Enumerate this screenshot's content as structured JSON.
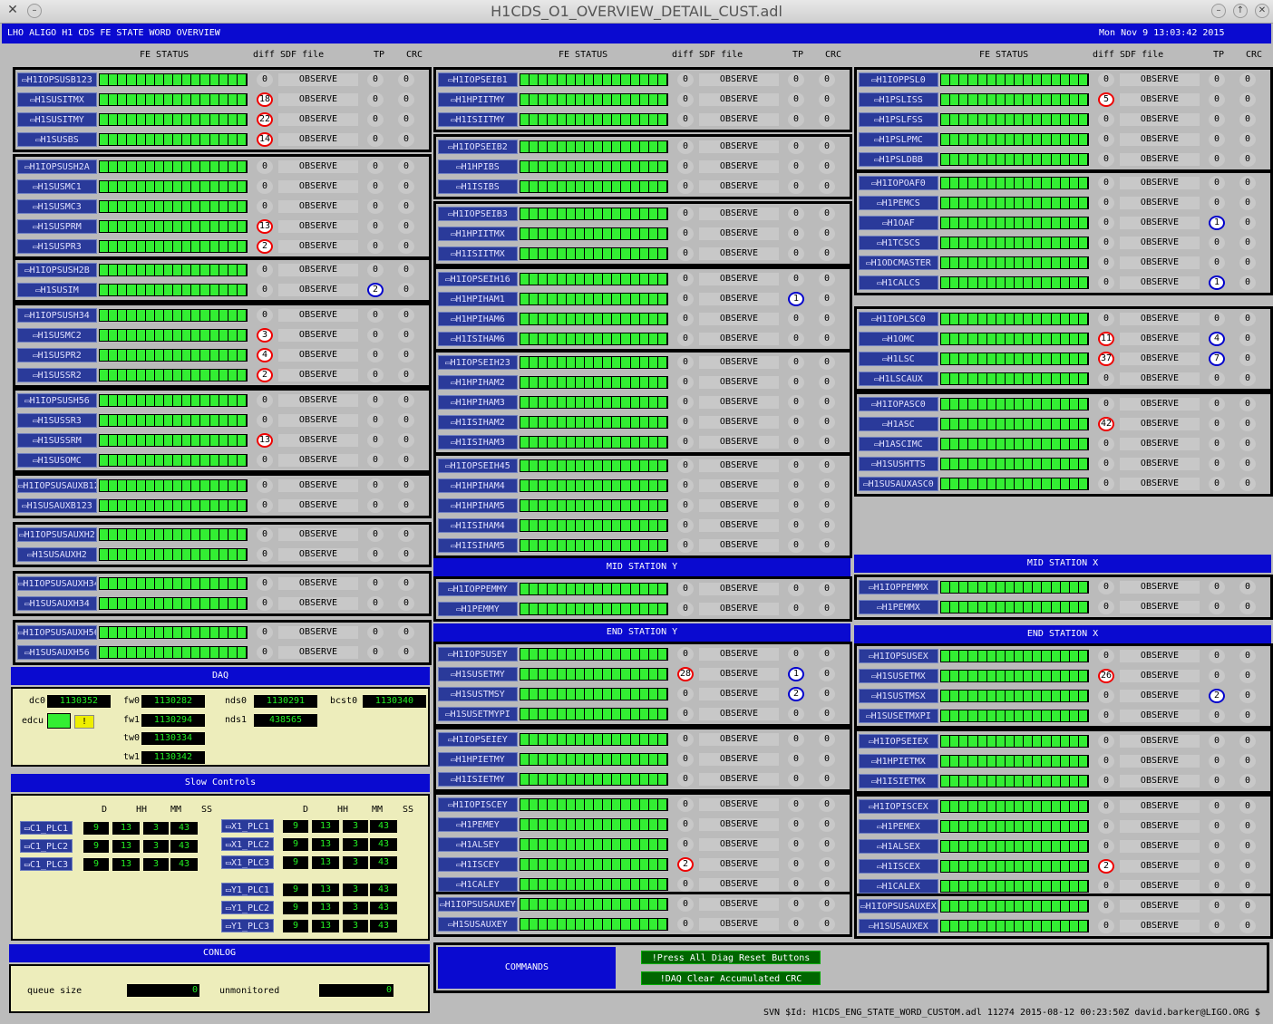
{
  "window": {
    "title": "H1CDS_O1_OVERVIEW_DETAIL_CUST.adl"
  },
  "banner": {
    "left": "LHO ALIGO H1 CDS FE STATE WORD OVERVIEW",
    "right": "Mon Nov  9 13:03:42 2015"
  },
  "col_headers": {
    "fe": "FE STATUS",
    "diff": "diff",
    "sdf": "SDF file",
    "tp": "TP",
    "crc": "CRC"
  },
  "observe": "OBSERVE",
  "columns": [
    {
      "groups": [
        [
          [
            "H1IOPSUSB123",
            "0",
            "0",
            "0"
          ],
          [
            "H1SUSITMX",
            "18",
            "0",
            "0"
          ],
          [
            "H1SUSITMY",
            "22",
            "0",
            "0"
          ],
          [
            "H1SUSBS",
            "14",
            "0",
            "0"
          ]
        ],
        [
          [
            "H1IOPSUSH2A",
            "0",
            "0",
            "0"
          ],
          [
            "H1SUSMC1",
            "0",
            "0",
            "0"
          ],
          [
            "H1SUSMC3",
            "0",
            "0",
            "0"
          ],
          [
            "H1SUSPRM",
            "13",
            "0",
            "0"
          ],
          [
            "H1SUSPR3",
            "2",
            "0",
            "0"
          ]
        ],
        [
          [
            "H1IOPSUSH2B",
            "0",
            "0",
            "0"
          ],
          [
            "H1SUSIM",
            "0",
            "2",
            "0"
          ]
        ],
        [
          [
            "H1IOPSUSH34",
            "0",
            "0",
            "0"
          ],
          [
            "H1SUSMC2",
            "3",
            "0",
            "0"
          ],
          [
            "H1SUSPR2",
            "4",
            "0",
            "0"
          ],
          [
            "H1SUSSR2",
            "2",
            "0",
            "0"
          ]
        ],
        [
          [
            "H1IOPSUSH56",
            "0",
            "0",
            "0"
          ],
          [
            "H1SUSSR3",
            "0",
            "0",
            "0"
          ],
          [
            "H1SUSSRM",
            "13",
            "0",
            "0"
          ],
          [
            "H1SUSOMC",
            "0",
            "0",
            "0"
          ]
        ],
        [
          [
            "H1IOPSUSAUXB123",
            "0",
            "0",
            "0"
          ],
          [
            "H1SUSAUXB123",
            "0",
            "0",
            "0"
          ]
        ],
        [
          [
            "H1IOPSUSAUXH2",
            "0",
            "0",
            "0"
          ],
          [
            "H1SUSAUXH2",
            "0",
            "0",
            "0"
          ]
        ],
        [
          [
            "H1IOPSUSAUXH34",
            "0",
            "0",
            "0"
          ],
          [
            "H1SUSAUXH34",
            "0",
            "0",
            "0"
          ]
        ],
        [
          [
            "H1IOPSUSAUXH56",
            "0",
            "0",
            "0"
          ],
          [
            "H1SUSAUXH56",
            "0",
            "0",
            "0"
          ]
        ]
      ]
    },
    {
      "groups": [
        [
          [
            "H1IOPSEIB1",
            "0",
            "0",
            "0"
          ],
          [
            "H1HPIITMY",
            "0",
            "0",
            "0"
          ],
          [
            "H1ISIITMY",
            "0",
            "0",
            "0"
          ]
        ],
        [
          [
            "H1IOPSEIB2",
            "0",
            "0",
            "0"
          ],
          [
            "H1HPIBS",
            "0",
            "0",
            "0"
          ],
          [
            "H1ISIBS",
            "0",
            "0",
            "0"
          ]
        ],
        [
          [
            "H1IOPSEIB3",
            "0",
            "0",
            "0"
          ],
          [
            "H1HPIITMX",
            "0",
            "0",
            "0"
          ],
          [
            "H1ISIITMX",
            "0",
            "0",
            "0"
          ]
        ],
        [
          [
            "H1IOPSEIH16",
            "0",
            "0",
            "0"
          ],
          [
            "H1HPIHAM1",
            "0",
            "1",
            "0"
          ],
          [
            "H1HPIHAM6",
            "0",
            "0",
            "0"
          ],
          [
            "H1ISIHAM6",
            "0",
            "0",
            "0"
          ]
        ],
        [
          [
            "H1IOPSEIH23",
            "0",
            "0",
            "0"
          ],
          [
            "H1HPIHAM2",
            "0",
            "0",
            "0"
          ],
          [
            "H1HPIHAM3",
            "0",
            "0",
            "0"
          ],
          [
            "H1ISIHAM2",
            "0",
            "0",
            "0"
          ],
          [
            "H1ISIHAM3",
            "0",
            "0",
            "0"
          ]
        ],
        [
          [
            "H1IOPSEIH45",
            "0",
            "0",
            "0"
          ],
          [
            "H1HPIHAM4",
            "0",
            "0",
            "0"
          ],
          [
            "H1HPIHAM5",
            "0",
            "0",
            "0"
          ],
          [
            "H1ISIHAM4",
            "0",
            "0",
            "0"
          ],
          [
            "H1ISIHAM5",
            "0",
            "0",
            "0"
          ]
        ]
      ]
    },
    {
      "groups": [
        [
          [
            "H1IOPPSL0",
            "0",
            "0",
            "0"
          ],
          [
            "H1PSLISS",
            "5",
            "0",
            "0"
          ],
          [
            "H1PSLFSS",
            "0",
            "0",
            "0"
          ],
          [
            "H1PSLPMC",
            "0",
            "0",
            "0"
          ],
          [
            "H1PSLDBB",
            "0",
            "0",
            "0"
          ]
        ],
        [
          [
            "H1IOPOAF0",
            "0",
            "0",
            "0"
          ],
          [
            "H1PEMCS",
            "0",
            "0",
            "0"
          ],
          [
            "H1OAF",
            "0",
            "1",
            "0"
          ],
          [
            "H1TCSCS",
            "0",
            "0",
            "0"
          ],
          [
            "H1ODCMASTER",
            "0",
            "0",
            "0"
          ],
          [
            "H1CALCS",
            "0",
            "1",
            "0"
          ]
        ],
        [
          [
            "H1IOPLSC0",
            "0",
            "0",
            "0"
          ],
          [
            "H1OMC",
            "11",
            "4",
            "0"
          ],
          [
            "H1LSC",
            "37",
            "7",
            "0"
          ],
          [
            "H1LSCAUX",
            "0",
            "0",
            "0"
          ]
        ],
        [
          [
            "H1IOPASC0",
            "0",
            "0",
            "0"
          ],
          [
            "H1ASC",
            "42",
            "0",
            "0"
          ],
          [
            "H1ASCIMC",
            "0",
            "0",
            "0"
          ],
          [
            "H1SUSHTTS",
            "0",
            "0",
            "0"
          ],
          [
            "H1SUSAUXASC0",
            "0",
            "0",
            "0"
          ]
        ]
      ]
    }
  ],
  "mid_y": {
    "title": "MID STATION Y",
    "rows": [
      [
        "H1IOPPEMMY",
        "0",
        "0",
        "0"
      ],
      [
        "H1PEMMY",
        "0",
        "0",
        "0"
      ]
    ]
  },
  "mid_x": {
    "title": "MID STATION X",
    "rows": [
      [
        "H1IOPPEMMX",
        "0",
        "0",
        "0"
      ],
      [
        "H1PEMMX",
        "0",
        "0",
        "0"
      ]
    ]
  },
  "end_y": {
    "title": "END STATION Y",
    "groups": [
      [
        [
          "H1IOPSUSEY",
          "0",
          "0",
          "0"
        ],
        [
          "H1SUSETMY",
          "28",
          "1",
          "0"
        ],
        [
          "H1SUSTMSY",
          "0",
          "2",
          "0"
        ],
        [
          "H1SUSETMYPI",
          "0",
          "0",
          "0"
        ]
      ],
      [
        [
          "H1IOPSEIEY",
          "0",
          "0",
          "0"
        ],
        [
          "H1HPIETMY",
          "0",
          "0",
          "0"
        ],
        [
          "H1ISIETMY",
          "0",
          "0",
          "0"
        ]
      ],
      [
        [
          "H1IOPISCEY",
          "0",
          "0",
          "0"
        ],
        [
          "H1PEMEY",
          "0",
          "0",
          "0"
        ],
        [
          "H1ALSEY",
          "0",
          "0",
          "0"
        ],
        [
          "H1ISCEY",
          "2",
          "0",
          "0"
        ],
        [
          "H1CALEY",
          "0",
          "0",
          "0"
        ]
      ],
      [
        [
          "H1IOPSUSAUXEY",
          "0",
          "0",
          "0"
        ],
        [
          "H1SUSAUXEY",
          "0",
          "0",
          "0"
        ]
      ]
    ]
  },
  "end_x": {
    "title": "END STATION X",
    "groups": [
      [
        [
          "H1IOPSUSEX",
          "0",
          "0",
          "0"
        ],
        [
          "H1SUSETMX",
          "26",
          "0",
          "0"
        ],
        [
          "H1SUSTMSX",
          "0",
          "2",
          "0"
        ],
        [
          "H1SUSETMXPI",
          "0",
          "0",
          "0"
        ]
      ],
      [
        [
          "H1IOPSEIEX",
          "0",
          "0",
          "0"
        ],
        [
          "H1HPIETMX",
          "0",
          "0",
          "0"
        ],
        [
          "H1ISIETMX",
          "0",
          "0",
          "0"
        ]
      ],
      [
        [
          "H1IOPISCEX",
          "0",
          "0",
          "0"
        ],
        [
          "H1PEMEX",
          "0",
          "0",
          "0"
        ],
        [
          "H1ALSEX",
          "0",
          "0",
          "0"
        ],
        [
          "H1ISCEX",
          "2",
          "0",
          "0"
        ],
        [
          "H1CALEX",
          "0",
          "0",
          "0"
        ]
      ],
      [
        [
          "H1IOPSUSAUXEX",
          "0",
          "0",
          "0"
        ],
        [
          "H1SUSAUXEX",
          "0",
          "0",
          "0"
        ]
      ]
    ]
  },
  "daq": {
    "title": "DAQ",
    "dc0_label": "dc0",
    "dc0": "1130352",
    "edcu_label": "edcu",
    "edcu_btn": "!",
    "fw0_label": "fw0",
    "fw0": "1130282",
    "fw1_label": "fw1",
    "fw1": "1130294",
    "tw0_label": "tw0",
    "tw0": "1130334",
    "tw1_label": "tw1",
    "tw1": "1130342",
    "nds0_label": "nds0",
    "nds0": "1130291",
    "nds1_label": "nds1",
    "nds1": "438565",
    "bcst0_label": "bcst0",
    "bcst0": "1130340"
  },
  "slow": {
    "title": "Slow Controls",
    "hdr": [
      "D",
      "HH",
      "MM",
      "SS"
    ],
    "left": [
      [
        "C1_PLC1",
        "9",
        "13",
        "3",
        "43"
      ],
      [
        "C1_PLC2",
        "9",
        "13",
        "3",
        "43"
      ],
      [
        "C1_PLC3",
        "9",
        "13",
        "3",
        "43"
      ]
    ],
    "mid": [
      [
        "X1_PLC1",
        "9",
        "13",
        "3",
        "43"
      ],
      [
        "X1_PLC2",
        "9",
        "13",
        "3",
        "43"
      ],
      [
        "X1_PLC3",
        "9",
        "13",
        "3",
        "43"
      ]
    ],
    "right": [
      [
        "Y1_PLC1",
        "9",
        "13",
        "3",
        "43"
      ],
      [
        "Y1_PLC2",
        "9",
        "13",
        "3",
        "43"
      ],
      [
        "Y1_PLC3",
        "9",
        "13",
        "3",
        "43"
      ]
    ]
  },
  "conlog": {
    "title": "CONLOG",
    "queue_label": "queue size",
    "queue": "0",
    "unmon_label": "unmonitored",
    "unmon": "0"
  },
  "commands": {
    "title": "COMMANDS",
    "btn1": "!Press All Diag Reset Buttons",
    "btn2": "!DAQ Clear Accumulated CRC"
  },
  "svn": "SVN $Id: H1CDS_ENG_STATE_WORD_CUSTOM.adl 11274 2015-08-12 00:23:50Z david.barker@LIGO.ORG $"
}
